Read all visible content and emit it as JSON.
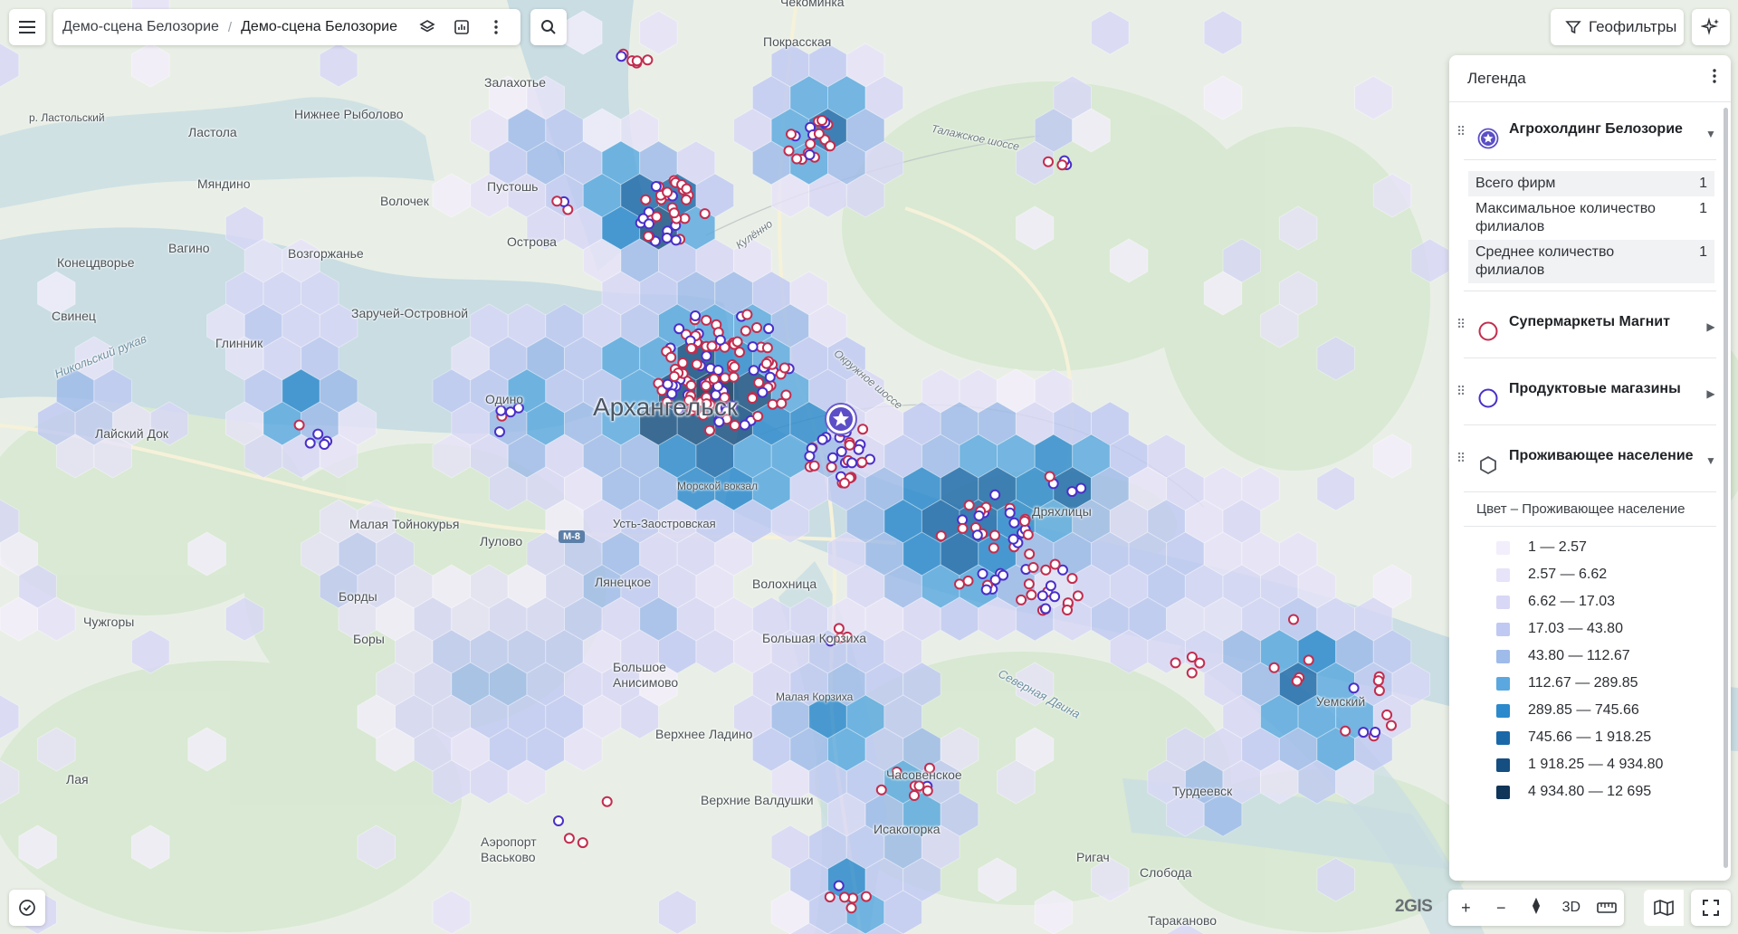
{
  "topbar": {
    "menu_icon": "hamburger-icon",
    "breadcrumb": [
      "Демо-сцена Белозорие",
      "Демо-сцена Белозорие"
    ],
    "geofilter_label": "Геофильтры"
  },
  "map": {
    "city_label": "Архангельск",
    "places": [
      "Покрасская",
      "Чекоминка",
      "Залахотье",
      "Нижнее Рыболово",
      "р. Ластольский",
      "Ластола",
      "Пустошь",
      "Мяндино",
      "Волочек",
      "Острова",
      "Кулённо",
      "Конецдворье",
      "Вагино",
      "Возгоржанье",
      "Свинец",
      "Заручей-Островной",
      "Никольский рукав",
      "Глинник",
      "Одино",
      "Лайский Док",
      "Малая Тойнокурья",
      "Лулово",
      "Усть-Заостровская",
      "Лянецкое",
      "Волохница",
      "Большая Корзиха",
      "Морской вокзал",
      "Борды",
      "Боры",
      "Чужгоры",
      "Большое Анисимово",
      "Малая Корзиха",
      "Верхнее Ладино",
      "Лая",
      "Верхние Валдушки",
      "Часовенское",
      "Исакогорка",
      "Аэропорт Васьково",
      "Турдеевск",
      "Ригач",
      "Слобода",
      "Тараканово",
      "Уемский",
      "Дряхлицы",
      "Талажское шоссе",
      "Окружное шоссе",
      "Северная Двина"
    ],
    "highway_label": "M-8",
    "brand": "2GIS"
  },
  "legend": {
    "title": "Легенда",
    "layers": [
      {
        "name": "Агрохолдинг Белозорие",
        "icon": "star-icon",
        "expanded": true
      },
      {
        "name": "Супермаркеты Магнит",
        "icon": "ring-red-icon",
        "expanded": false
      },
      {
        "name": "Продуктовые магазины",
        "icon": "ring-purple-icon",
        "expanded": false
      },
      {
        "name": "Проживающее население",
        "icon": "hexagon-icon",
        "expanded": true
      }
    ],
    "stats": [
      {
        "label": "Всего фирм",
        "value": "1"
      },
      {
        "label": "Максимальное количество филиалов",
        "value": "1"
      },
      {
        "label": "Среднее количество филиалов",
        "value": "1"
      }
    ],
    "scale_caption": "Цвет – Проживающее население",
    "scale": [
      {
        "range": "1 — 2.57",
        "color": "#f3eefb"
      },
      {
        "range": "2.57 — 6.62",
        "color": "#e7e3f8"
      },
      {
        "range": "6.62 — 17.03",
        "color": "#d8d7f5"
      },
      {
        "range": "17.03 — 43.80",
        "color": "#c0c9f1"
      },
      {
        "range": "43.80 — 112.67",
        "color": "#9fbbe9"
      },
      {
        "range": "112.67 — 289.85",
        "color": "#5aa8df"
      },
      {
        "range": "289.85 — 745.66",
        "color": "#2b89cc"
      },
      {
        "range": "745.66 — 1 918.25",
        "color": "#1a68a8"
      },
      {
        "range": "1 918.25 — 4 934.80",
        "color": "#154e80"
      },
      {
        "range": "4 934.80 — 12 695",
        "color": "#0f3558"
      }
    ]
  },
  "controls": {
    "zoom_in": "+",
    "zoom_out": "−",
    "mode_3d": "3D"
  }
}
